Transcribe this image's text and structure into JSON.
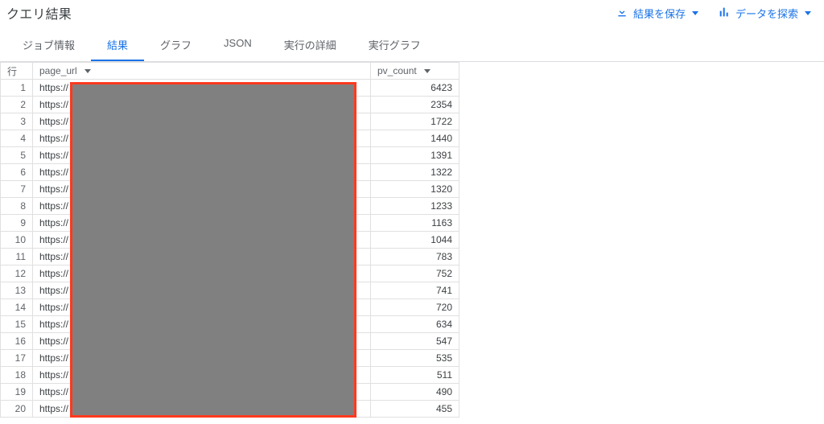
{
  "header": {
    "title": "クエリ結果",
    "save_label": "結果を保存",
    "explore_label": "データを探索"
  },
  "tabs": {
    "job_info": "ジョブ情報",
    "results": "結果",
    "graph": "グラフ",
    "json": "JSON",
    "exec_detail": "実行の詳細",
    "exec_graph": "実行グラフ"
  },
  "columns": {
    "row": "行",
    "page_url": "page_url",
    "pv_count": "pv_count"
  },
  "rows": [
    {
      "n": 1,
      "url": "https://",
      "pv": 6423
    },
    {
      "n": 2,
      "url": "https://",
      "pv": 2354
    },
    {
      "n": 3,
      "url": "https://",
      "pv": 1722
    },
    {
      "n": 4,
      "url": "https://",
      "pv": 1440
    },
    {
      "n": 5,
      "url": "https://",
      "pv": 1391
    },
    {
      "n": 6,
      "url": "https://",
      "pv": 1322
    },
    {
      "n": 7,
      "url": "https://",
      "pv": 1320
    },
    {
      "n": 8,
      "url": "https://",
      "pv": 1233
    },
    {
      "n": 9,
      "url": "https://",
      "pv": 1163
    },
    {
      "n": 10,
      "url": "https://",
      "pv": 1044
    },
    {
      "n": 11,
      "url": "https://",
      "pv": 783
    },
    {
      "n": 12,
      "url": "https://",
      "pv": 752
    },
    {
      "n": 13,
      "url": "https://",
      "pv": 741
    },
    {
      "n": 14,
      "url": "https://",
      "pv": 720
    },
    {
      "n": 15,
      "url": "https://",
      "pv": 634
    },
    {
      "n": 16,
      "url": "https://",
      "pv": 547
    },
    {
      "n": 17,
      "url": "https://",
      "pv": 535
    },
    {
      "n": 18,
      "url": "https://",
      "pv": 511
    },
    {
      "n": 19,
      "url": "https://",
      "pv": 490
    },
    {
      "n": 20,
      "url": "https://",
      "pv": 455
    }
  ]
}
